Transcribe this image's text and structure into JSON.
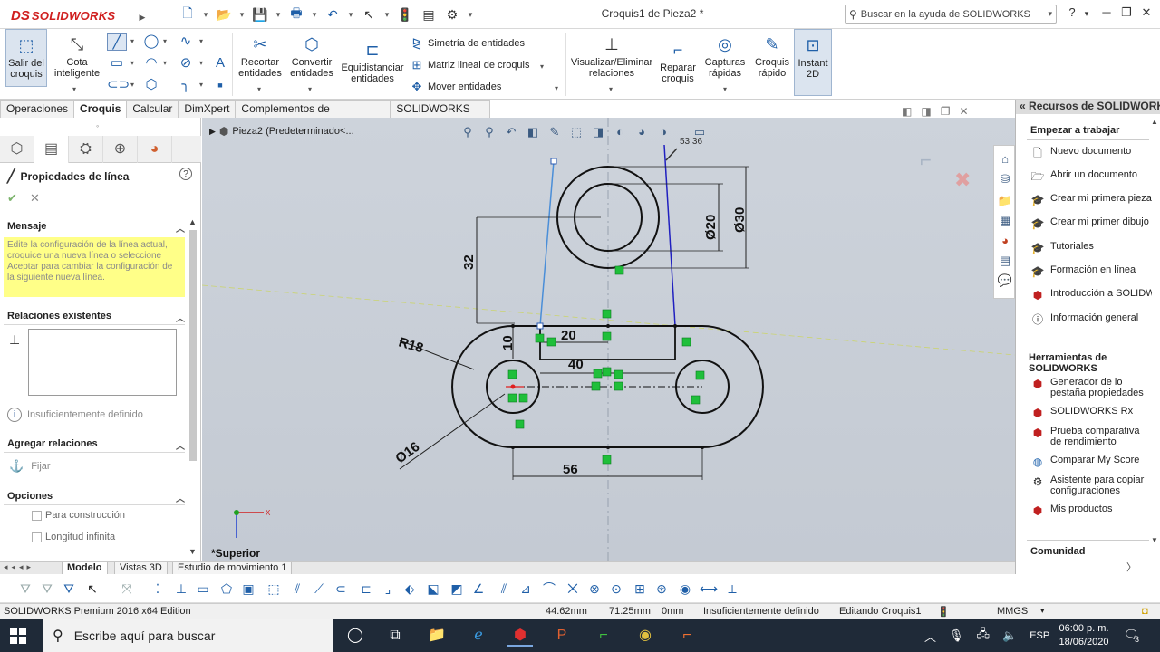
{
  "app": {
    "brand_ds": "DS",
    "brand_name": "SOLIDWORKS",
    "document_title": "Croquis1 de Pieza2 *",
    "help_search_placeholder": "Buscar en la ayuda de SOLIDWORKS",
    "help_label": "?"
  },
  "ribbon": {
    "exit_sketch": "Salir del croquis",
    "smart_dim": "Cota inteligente",
    "trim": "Recortar entidades",
    "convert": "Convertir entidades",
    "offset": "Equidistanciar entidades",
    "mirror": "Simetría de entidades",
    "linear_pattern": "Matriz lineal de croquis",
    "move": "Mover entidades",
    "relations": "Visualizar/Eliminar relaciones",
    "repair": "Reparar croquis",
    "quick_snaps": "Capturas rápidas",
    "rapid_sketch": "Croquis rápido",
    "instant2d": "Instant 2D"
  },
  "command_tabs": [
    "Operaciones",
    "Croquis",
    "Calcular",
    "DimXpert",
    "Complementos de SOLIDWORKS",
    "SOLIDWORKS MBD"
  ],
  "property_manager": {
    "title": "Propiedades de línea",
    "message_header": "Mensaje",
    "message_text": "Edite la configuración de la línea actual, croquice una nueva línea o seleccione Aceptar para cambiar la configuración de la siguiente nueva línea.",
    "existing_relations_header": "Relaciones existentes",
    "status": "Insuficientemente definido",
    "add_relations_header": "Agregar relaciones",
    "fix_label": "Fijar",
    "options_header": "Opciones",
    "for_construction": "Para construcción",
    "infinite_length": "Longitud infinita"
  },
  "viewport": {
    "tree_label": "Pieza2  (Predeterminado<...",
    "view_orientation": "*Superior",
    "angle_readout": "53.36",
    "dimensions": {
      "d_small_circle": "Ø20",
      "d_big_circle": "Ø30",
      "vertical_32": "32",
      "radius_18": "R18",
      "vertical_10": "10",
      "horizontal_20": "20",
      "horizontal_40": "40",
      "diameter_16": "Ø16",
      "horizontal_56": "56"
    }
  },
  "bottom_tabs": [
    "Modelo",
    "Vistas 3D",
    "Estudio de movimiento 1"
  ],
  "status_bar": {
    "edition": "SOLIDWORKS Premium 2016 x64 Edition",
    "x": "44.62mm",
    "y": "71.25mm",
    "z": "0mm",
    "definition": "Insuficientemente definido",
    "editing": "Editando Croquis1",
    "units": "MMGS"
  },
  "task_pane": {
    "header": "Recursos de SOLIDWORKS",
    "get_started": "Empezar a trabajar",
    "items_start": [
      "Nuevo documento",
      "Abrir un documento",
      "Crear mi primera pieza",
      "Crear mi primer dibujo",
      "Tutoriales",
      "Formación en línea",
      "Introducción a SOLIDWORKS",
      "Información general"
    ],
    "tools_header": "Herramientas de SOLIDWORKS",
    "tools": [
      "Generador de lo pestaña propiedades",
      "SOLIDWORKS Rx",
      "Prueba comparativa de rendimiento",
      "Comparar My Score",
      "Asistente para copiar configuraciones",
      "Mis productos"
    ],
    "community_header": "Comunidad"
  },
  "taskbar": {
    "search_placeholder": "Escribe aquí para buscar",
    "language": "ESP",
    "time": "06:00 p. m.",
    "date": "18/06/2020",
    "notifications": "3"
  }
}
